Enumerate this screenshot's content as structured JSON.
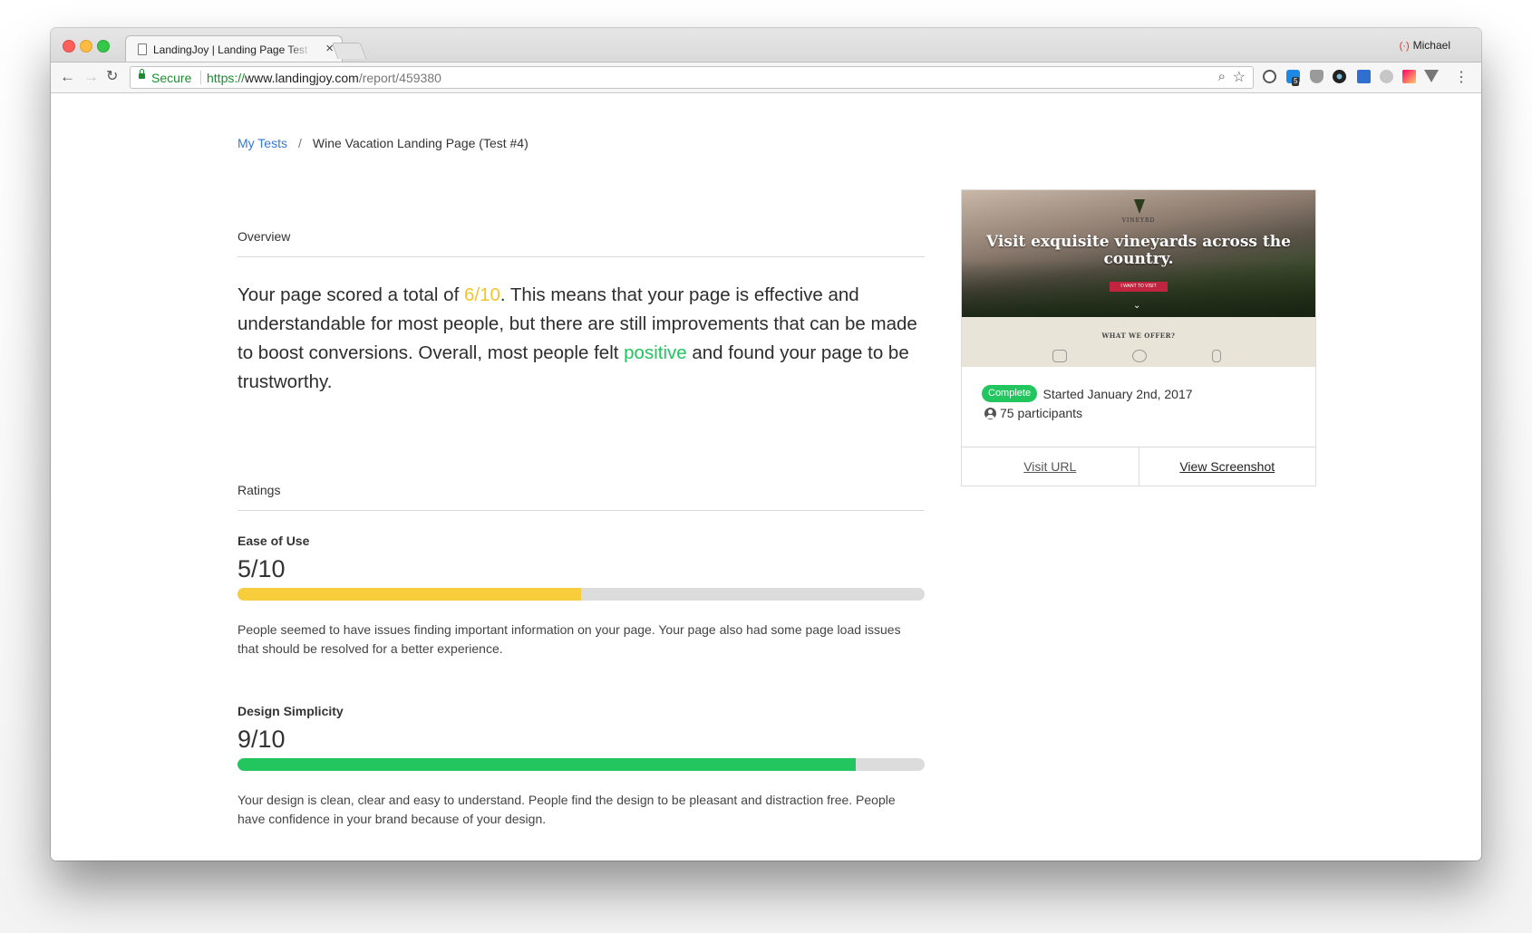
{
  "browser": {
    "tab_title": "LandingJoy | Landing Page Test",
    "profile_name": "Michael",
    "secure_label": "Secure",
    "url_scheme": "https://",
    "url_host": "www.landingjoy.com",
    "url_path": "/report/459380",
    "extension_badge": "5"
  },
  "breadcrumb": {
    "root": "My Tests",
    "separator": "/",
    "current": "Wine Vacation Landing Page (Test #4)"
  },
  "overview": {
    "label": "Overview",
    "summary_pre": "Your page scored a total of ",
    "score": "6/10",
    "summary_mid": ". This means that your page is effective and understandable for most people, but there are still improvements that can be made to boost conversions. Overall, most people felt ",
    "sentiment": "positive",
    "summary_post": " and found your page to be trustworthy."
  },
  "ratings": {
    "label": "Ratings",
    "items": [
      {
        "name": "Ease of Use",
        "score": "5/10",
        "fraction": 0.5,
        "color": "#f7cd3c",
        "description": "People seemed to have issues finding important information on your page. Your page also had some page load issues that should be resolved for a better experience."
      },
      {
        "name": "Design Simplicity",
        "score": "9/10",
        "fraction": 0.9,
        "color": "#22c55e",
        "description": "Your design is clean, clear and easy to understand. People find the design to be pleasant and distraction free. People have confidence in your brand because of your design."
      }
    ]
  },
  "card": {
    "thumbnail": {
      "headline": "Visit exquisite vineyards across the country.",
      "brand": "VINEYRD",
      "cta": "I WANT TO VISIT",
      "offer": "WHAT WE OFFER?"
    },
    "status": "Complete",
    "started": "Started January 2nd, 2017",
    "participants": "75 participants",
    "visit_url_label": "Visit URL",
    "view_screenshot_label": "View Screenshot"
  },
  "colors": {
    "accent_blue": "#3478d4",
    "score_yellow": "#f5c32c",
    "positive_green": "#22c55e",
    "secure_green": "#1a8e2f"
  }
}
